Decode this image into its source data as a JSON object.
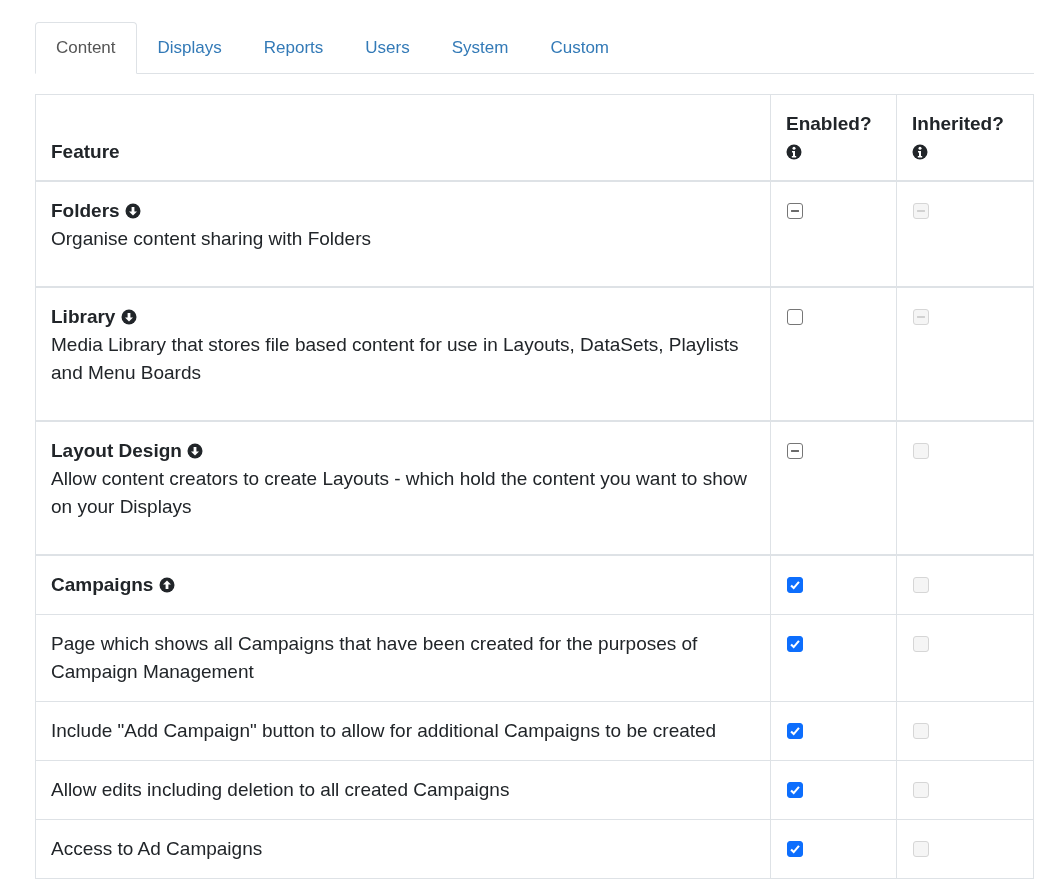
{
  "tabs": [
    {
      "label": "Content",
      "selected": true
    },
    {
      "label": "Displays",
      "selected": false
    },
    {
      "label": "Reports",
      "selected": false
    },
    {
      "label": "Users",
      "selected": false
    },
    {
      "label": "System",
      "selected": false
    },
    {
      "label": "Custom",
      "selected": false
    }
  ],
  "table": {
    "columns": [
      "Feature",
      "Enabled?",
      "Inherited?"
    ],
    "rows": [
      {
        "kind": "group",
        "title": "Folders",
        "expanded": false,
        "description": "Organise content sharing with Folders",
        "enabled": {
          "checked": true,
          "indeterminate": true,
          "disabled": false
        },
        "inherited": {
          "checked": true,
          "indeterminate": true,
          "disabled": true
        }
      },
      {
        "kind": "group",
        "title": "Library",
        "expanded": false,
        "description": "Media Library that stores file based content for use in Layouts, DataSets, Playlists and Menu Boards",
        "enabled": {
          "checked": false,
          "indeterminate": false,
          "disabled": false
        },
        "inherited": {
          "checked": true,
          "indeterminate": true,
          "disabled": true
        }
      },
      {
        "kind": "group",
        "title": "Layout Design",
        "expanded": false,
        "description": "Allow content creators to create Layouts - which hold the content you want to show on your Displays",
        "enabled": {
          "checked": true,
          "indeterminate": true,
          "disabled": false
        },
        "inherited": {
          "checked": false,
          "indeterminate": false,
          "disabled": true
        }
      },
      {
        "kind": "group",
        "title": "Campaigns",
        "expanded": true,
        "enabled": {
          "checked": true,
          "indeterminate": false,
          "disabled": false
        },
        "inherited": {
          "checked": false,
          "indeterminate": false,
          "disabled": true
        }
      },
      {
        "kind": "item",
        "description": "Page which shows all Campaigns that have been created for the purposes of Campaign Management",
        "enabled": {
          "checked": true,
          "indeterminate": false,
          "disabled": false
        },
        "inherited": {
          "checked": false,
          "indeterminate": false,
          "disabled": true
        }
      },
      {
        "kind": "item",
        "description": "Include \"Add Campaign\" button to allow for additional Campaigns to be created",
        "enabled": {
          "checked": true,
          "indeterminate": false,
          "disabled": false
        },
        "inherited": {
          "checked": false,
          "indeterminate": false,
          "disabled": true
        }
      },
      {
        "kind": "item",
        "description": "Allow edits including deletion to all created Campaigns",
        "enabled": {
          "checked": true,
          "indeterminate": false,
          "disabled": false
        },
        "inherited": {
          "checked": false,
          "indeterminate": false,
          "disabled": true
        }
      },
      {
        "kind": "item",
        "description": "Access to Ad Campaigns",
        "enabled": {
          "checked": true,
          "indeterminate": false,
          "disabled": false
        },
        "inherited": {
          "checked": false,
          "indeterminate": false,
          "disabled": true
        }
      }
    ]
  }
}
